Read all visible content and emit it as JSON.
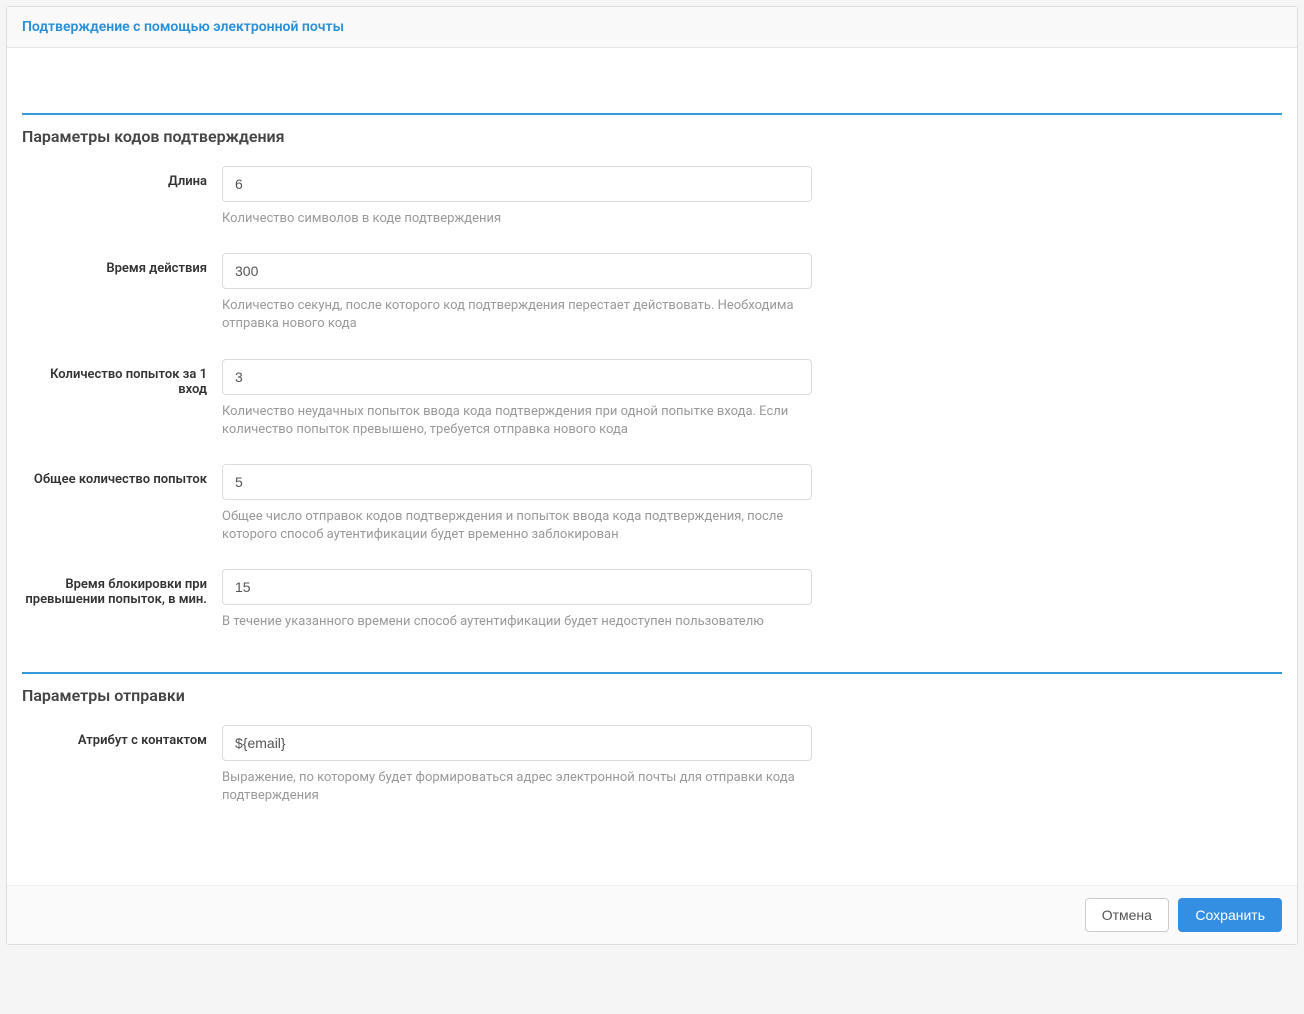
{
  "header": {
    "title": "Подтверждение с помощью электронной почты"
  },
  "section1": {
    "title": "Параметры кодов подтверждения",
    "fields": {
      "length": {
        "label": "Длина",
        "value": "6",
        "help": "Количество символов в коде подтверждения"
      },
      "ttl": {
        "label": "Время действия",
        "value": "300",
        "help": "Количество секунд, после которого код подтверждения перестает действовать. Необходима отправка нового кода"
      },
      "attemptsPerLogin": {
        "label": "Количество попыток за 1 вход",
        "value": "3",
        "help": "Количество неудачных попыток ввода кода подтверждения при одной попытке входа. Если количество попыток превышено, требуется отправка нового кода"
      },
      "totalAttempts": {
        "label": "Общее количество попыток",
        "value": "5",
        "help": "Общее число отправок кодов подтверждения и попыток ввода кода подтверждения, после которого способ аутентификации будет временно заблокирован"
      },
      "lockTime": {
        "label": "Время блокировки при превышении попыток, в мин.",
        "value": "15",
        "help": "В течение указанного времени способ аутентификации будет недоступен пользователю"
      }
    }
  },
  "section2": {
    "title": "Параметры отправки",
    "fields": {
      "contactAttr": {
        "label": "Атрибут с контактом",
        "value": "${email}",
        "help": "Выражение, по которому будет формироваться адрес электронной почты для отправки кода подтверждения"
      }
    }
  },
  "footer": {
    "cancel": "Отмена",
    "save": "Сохранить"
  }
}
